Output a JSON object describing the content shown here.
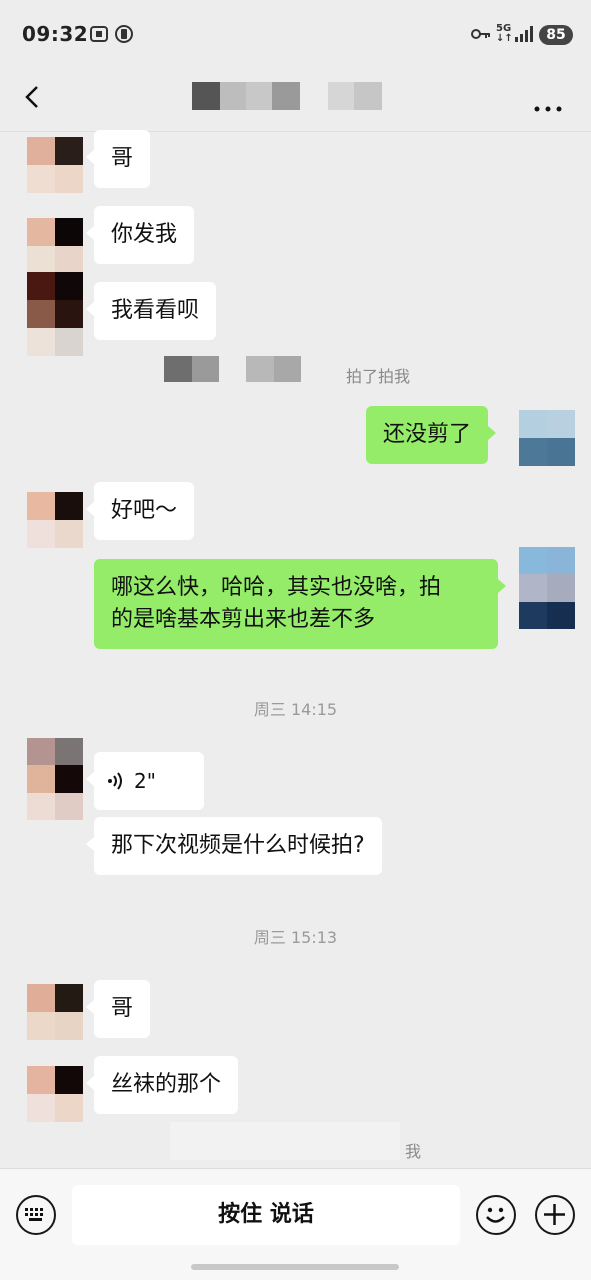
{
  "status_bar": {
    "time": "09:32",
    "battery": "85",
    "network": "5G"
  },
  "nav": {
    "back_icon": "chevron-left-icon",
    "more_icon": "more-horizontal-icon"
  },
  "messages": {
    "m1": "哥",
    "m2": "你发我",
    "m3": "我看看呗",
    "pat": "拍了拍我",
    "m4": "还没剪了",
    "m5": "好吧～",
    "m6_line1": "哪这么快，哈哈，其实也没啥，拍",
    "m6_line2": "的是啥基本剪出来也差不多",
    "stamp1": "周三 14:15",
    "voice_duration": "2\"",
    "m7": "那下次视频是什么时候拍?",
    "stamp2": "周三 15:13",
    "m8": "哥",
    "m9": "丝袜的那个",
    "partial": "我"
  },
  "bottom": {
    "talk_label": "按住 说话"
  },
  "colors": {
    "bg": "#ededed",
    "green": "#95ec69",
    "white": "#ffffff"
  }
}
